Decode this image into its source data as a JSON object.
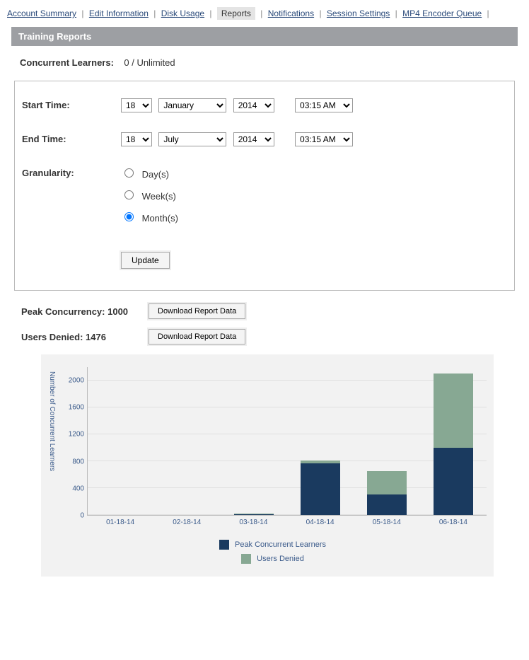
{
  "nav": {
    "items": [
      {
        "label": "Account Summary",
        "active": false
      },
      {
        "label": "Edit Information",
        "active": false
      },
      {
        "label": "Disk Usage",
        "active": false
      },
      {
        "label": "Reports",
        "active": true
      },
      {
        "label": "Notifications",
        "active": false
      },
      {
        "label": "Session Settings",
        "active": false
      },
      {
        "label": "MP4 Encoder Queue",
        "active": false
      }
    ]
  },
  "header": {
    "title": "Training Reports"
  },
  "concurrent": {
    "label": "Concurrent Learners:",
    "value": "0 / Unlimited"
  },
  "form": {
    "start_label": "Start Time:",
    "end_label": "End Time:",
    "granularity_label": "Granularity:",
    "start": {
      "day": "18",
      "month": "January",
      "year": "2014",
      "time": "03:15 AM"
    },
    "end": {
      "day": "18",
      "month": "July",
      "year": "2014",
      "time": "03:15 AM"
    },
    "granularity": {
      "options": [
        {
          "label": "Day(s)",
          "checked": false
        },
        {
          "label": "Week(s)",
          "checked": false
        },
        {
          "label": "Month(s)",
          "checked": true
        }
      ]
    },
    "update_label": "Update"
  },
  "stats": {
    "peak": {
      "label": "Peak Concurrency: 1000",
      "button": "Download Report Data"
    },
    "denied": {
      "label": "Users Denied: 1476",
      "button": "Download Report Data"
    }
  },
  "chart_data": {
    "type": "bar",
    "title": "",
    "xlabel": "",
    "ylabel": "Number of Concurrent Learners",
    "ylim": [
      0,
      2200
    ],
    "yticks": [
      0,
      400,
      800,
      1200,
      1600,
      2000
    ],
    "categories": [
      "01-18-14",
      "02-18-14",
      "03-18-14",
      "04-18-14",
      "05-18-14",
      "06-18-14"
    ],
    "series": [
      {
        "name": "Peak Concurrent Learners",
        "color": "#1a3a5f",
        "values": [
          0,
          0,
          10,
          770,
          300,
          1000
        ]
      },
      {
        "name": "Users Denied",
        "color": "#87a893",
        "values": [
          0,
          0,
          10,
          40,
          350,
          1100
        ]
      }
    ],
    "legend_position": "bottom"
  }
}
